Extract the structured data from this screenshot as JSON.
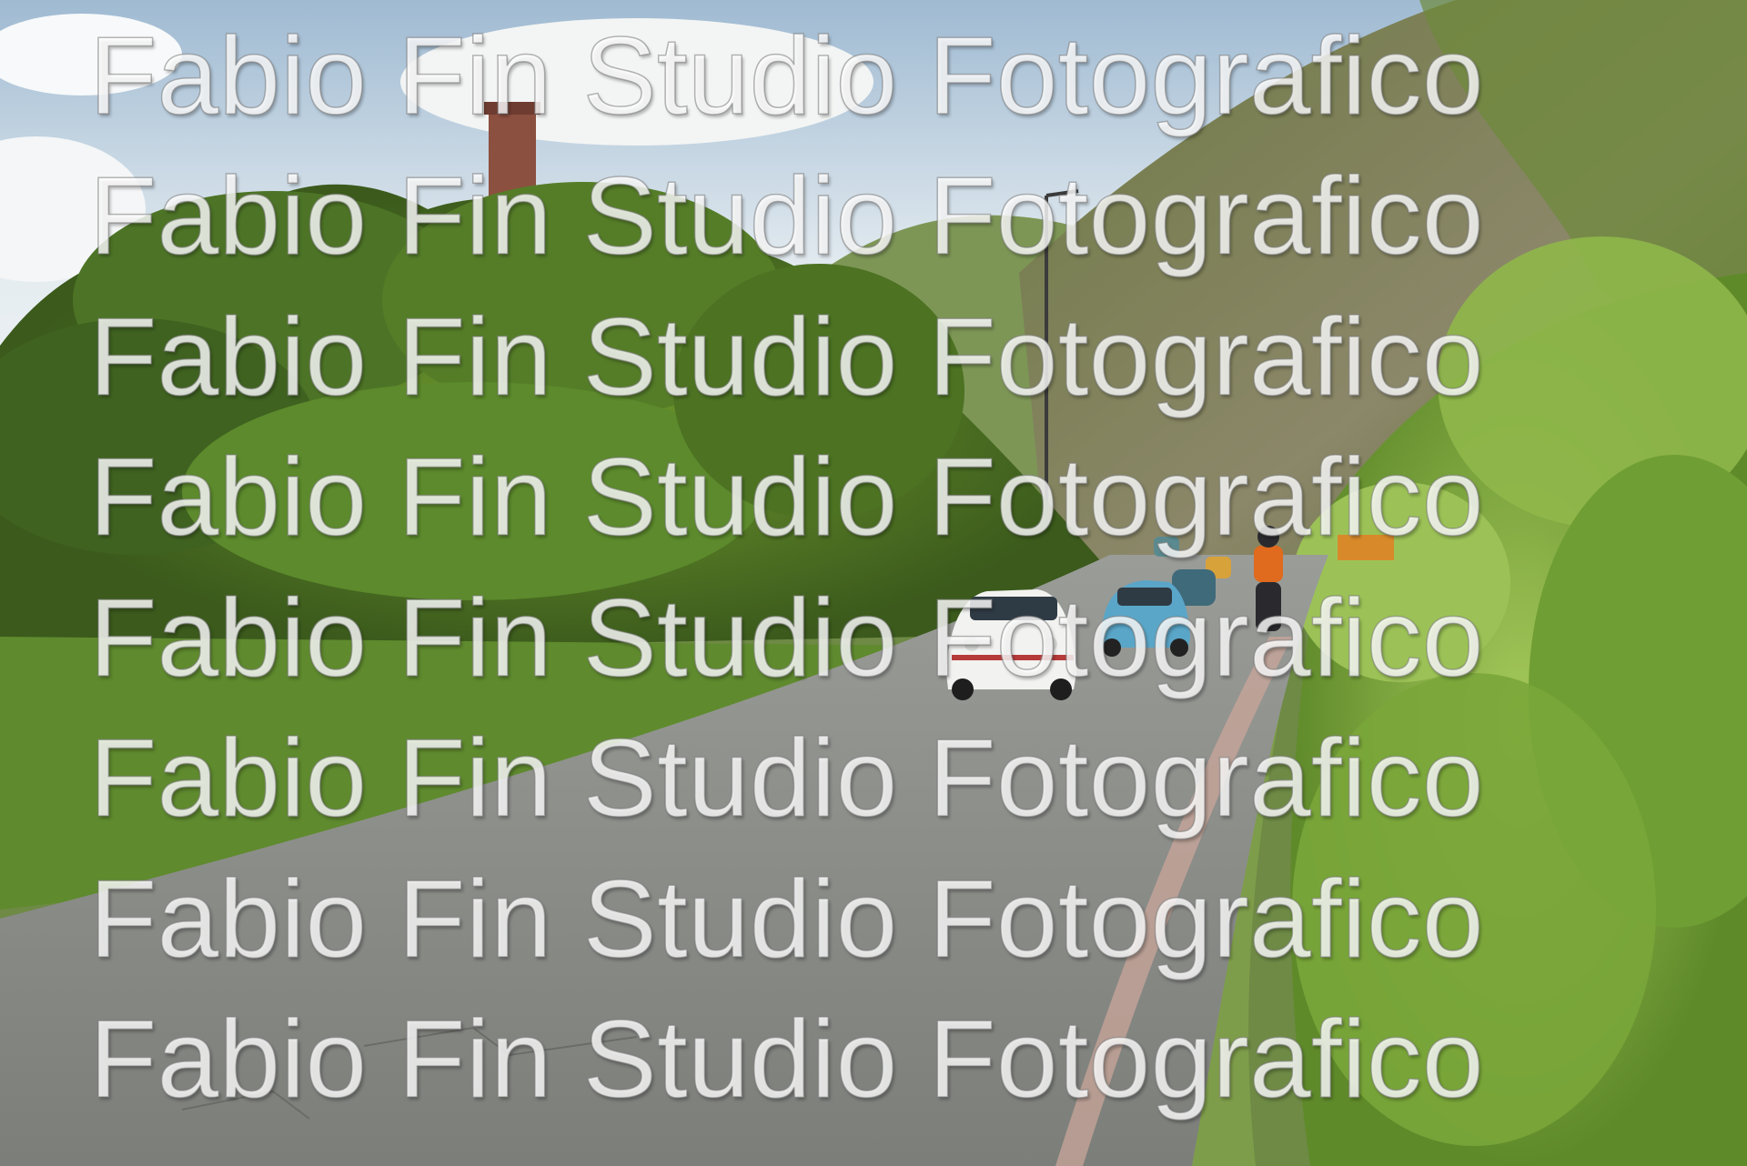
{
  "photo": {
    "subject": "",
    "colors": {
      "sky": "#dfe8ee",
      "foliage_dark": "#3e5a1e",
      "foliage_light": "#86ad3c",
      "cliff": "#7c7a5a",
      "road": "#8a8c88",
      "tower": "#8a4f3a"
    }
  },
  "watermark": {
    "lines": [
      "Fabio Fin Studio Fotografico",
      "Fabio Fin Studio Fotografico",
      "Fabio Fin Studio Fotografico",
      "Fabio Fin Studio Fotografico",
      "Fabio Fin Studio Fotografico",
      "Fabio Fin Studio Fotografico",
      "Fabio Fin Studio Fotografico",
      "Fabio Fin Studio Fotografico"
    ]
  }
}
